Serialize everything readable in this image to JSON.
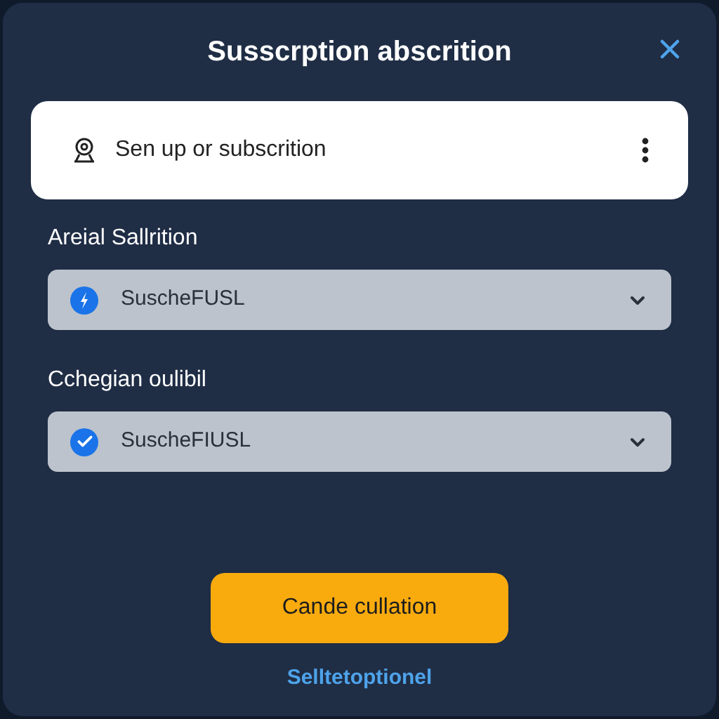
{
  "dialog": {
    "title": "Susscrption abscrition"
  },
  "account_row": {
    "text": "Sen up or subscrition"
  },
  "fields": [
    {
      "label": "Areial Sallrition",
      "value": "SuscheFUSL",
      "kind": "bolt"
    },
    {
      "label": "Cchegian oulibil",
      "value": "SuscheFIUSL",
      "kind": "check"
    }
  ],
  "primary_button": "Cande cullation",
  "link": "Selltetoptionel"
}
